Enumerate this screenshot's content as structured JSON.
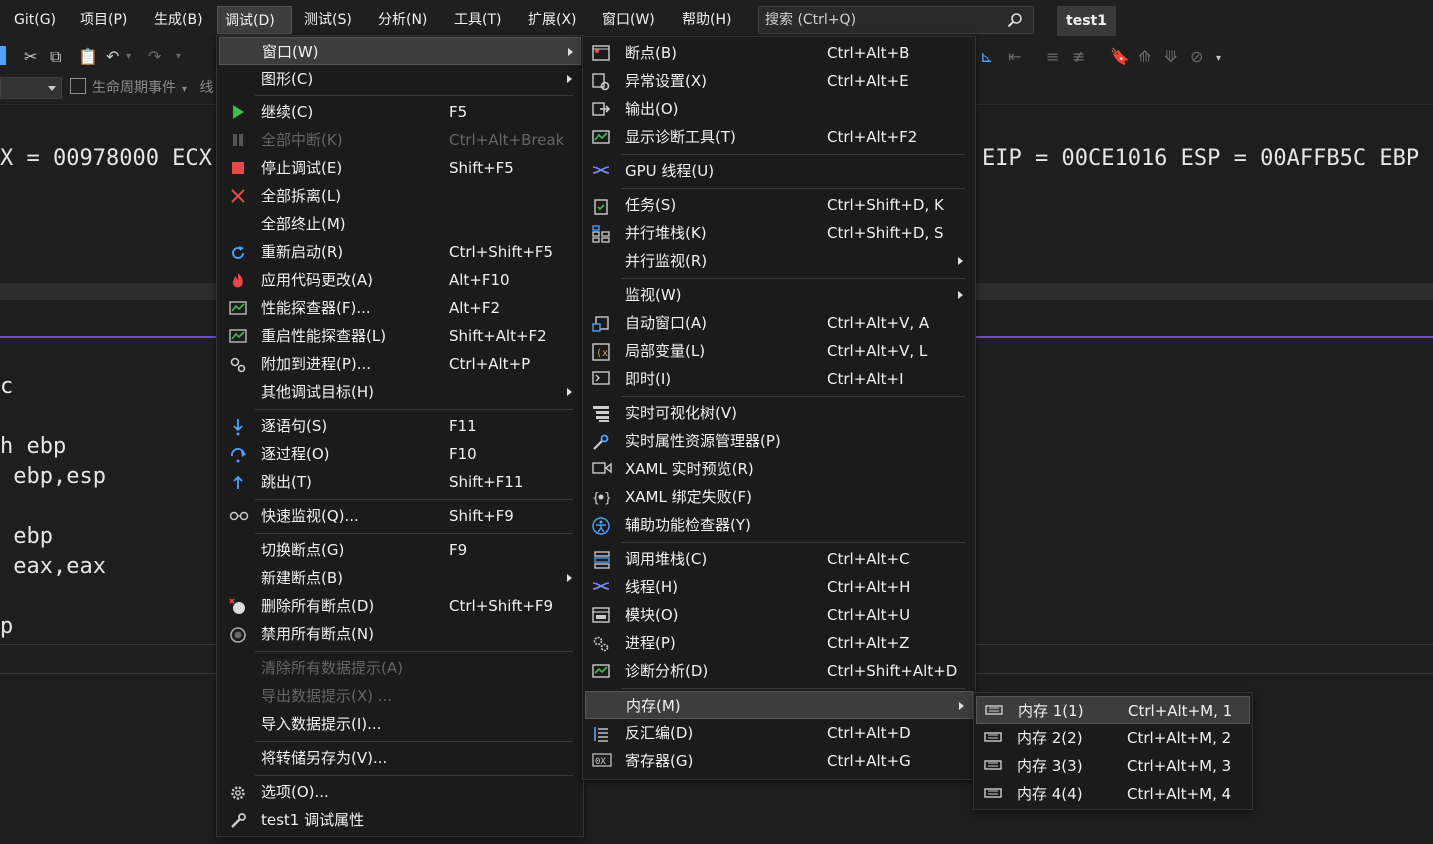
{
  "menubar": {
    "items": [
      {
        "label": "Git(G)"
      },
      {
        "label": "项目(P)"
      },
      {
        "label": "生成(B)"
      },
      {
        "label": "调试(D)"
      },
      {
        "label": "测试(S)"
      },
      {
        "label": "分析(N)"
      },
      {
        "label": "工具(T)"
      },
      {
        "label": "扩展(X)"
      },
      {
        "label": "窗口(W)"
      },
      {
        "label": "帮助(H)"
      }
    ],
    "search_placeholder": "搜索 (Ctrl+Q)",
    "project_name": "test1"
  },
  "toolbar2": {
    "lifecycle_label": "生命周期事件",
    "truncated_text": "线"
  },
  "registers": {
    "left": "X = 00978000 ECX",
    "right": "EIP = 00CE1016 ESP = 00AFFB5C EBP"
  },
  "code": {
    "lines": [
      "c",
      "h ebp",
      " ebp,esp",
      " ebp",
      " eax,eax",
      "p"
    ]
  },
  "debug_menu": {
    "items": [
      {
        "label": "窗口(W)",
        "shortcut": "",
        "icon": "",
        "submenu": true,
        "disabled": false,
        "highlighted": true
      },
      {
        "label": "图形(C)",
        "shortcut": "",
        "icon": "",
        "submenu": true,
        "disabled": false
      },
      {
        "label": "继续(C)",
        "shortcut": "F5",
        "icon": "play-icon",
        "submenu": false,
        "disabled": false
      },
      {
        "label": "全部中断(K)",
        "shortcut": "Ctrl+Alt+Break",
        "icon": "pause-icon",
        "submenu": false,
        "disabled": true
      },
      {
        "label": "停止调试(E)",
        "shortcut": "Shift+F5",
        "icon": "stop-icon",
        "submenu": false,
        "disabled": false
      },
      {
        "label": "全部拆离(L)",
        "shortcut": "",
        "icon": "detach-icon",
        "submenu": false,
        "disabled": false
      },
      {
        "label": "全部终止(M)",
        "shortcut": "",
        "icon": "",
        "submenu": false,
        "disabled": false
      },
      {
        "label": "重新启动(R)",
        "shortcut": "Ctrl+Shift+F5",
        "icon": "restart-icon",
        "submenu": false,
        "disabled": false
      },
      {
        "label": "应用代码更改(A)",
        "shortcut": "Alt+F10",
        "icon": "hot-reload-icon",
        "submenu": false,
        "disabled": false
      },
      {
        "label": "性能探查器(F)...",
        "shortcut": "Alt+F2",
        "icon": "profiler-icon",
        "submenu": false,
        "disabled": false
      },
      {
        "label": "重启性能探查器(L)",
        "shortcut": "Shift+Alt+F2",
        "icon": "profiler-icon",
        "submenu": false,
        "disabled": false
      },
      {
        "label": "附加到进程(P)...",
        "shortcut": "Ctrl+Alt+P",
        "icon": "attach-process-icon",
        "submenu": false,
        "disabled": false
      },
      {
        "label": "其他调试目标(H)",
        "shortcut": "",
        "icon": "",
        "submenu": true,
        "disabled": false
      },
      {
        "label": "逐语句(S)",
        "shortcut": "F11",
        "icon": "step-into-icon",
        "submenu": false,
        "disabled": false
      },
      {
        "label": "逐过程(O)",
        "shortcut": "F10",
        "icon": "step-over-icon",
        "submenu": false,
        "disabled": false
      },
      {
        "label": "跳出(T)",
        "shortcut": "Shift+F11",
        "icon": "step-out-icon",
        "submenu": false,
        "disabled": false
      },
      {
        "label": "快速监视(Q)...",
        "shortcut": "Shift+F9",
        "icon": "glasses-icon",
        "submenu": false,
        "disabled": false
      },
      {
        "label": "切换断点(G)",
        "shortcut": "F9",
        "icon": "",
        "submenu": false,
        "disabled": false
      },
      {
        "label": "新建断点(B)",
        "shortcut": "",
        "icon": "",
        "submenu": true,
        "disabled": false
      },
      {
        "label": "删除所有断点(D)",
        "shortcut": "Ctrl+Shift+F9",
        "icon": "delete-breakpoints-icon",
        "submenu": false,
        "disabled": false
      },
      {
        "label": "禁用所有断点(N)",
        "shortcut": "",
        "icon": "disable-breakpoints-icon",
        "submenu": false,
        "disabled": false
      },
      {
        "label": "清除所有数据提示(A)",
        "shortcut": "",
        "icon": "",
        "submenu": false,
        "disabled": true
      },
      {
        "label": "导出数据提示(X) ...",
        "shortcut": "",
        "icon": "",
        "submenu": false,
        "disabled": true
      },
      {
        "label": "导入数据提示(I)...",
        "shortcut": "",
        "icon": "",
        "submenu": false,
        "disabled": false
      },
      {
        "label": "将转储另存为(V)...",
        "shortcut": "",
        "icon": "",
        "submenu": false,
        "disabled": false
      },
      {
        "label": "选项(O)...",
        "shortcut": "",
        "icon": "gear-icon",
        "submenu": false,
        "disabled": false
      },
      {
        "label": "test1 调试属性",
        "shortcut": "",
        "icon": "wrench-icon",
        "submenu": false,
        "disabled": false
      }
    ]
  },
  "window_menu": {
    "items": [
      {
        "label": "断点(B)",
        "shortcut": "Ctrl+Alt+B",
        "icon": "breakpoints-window-icon",
        "submenu": false
      },
      {
        "label": "异常设置(X)",
        "shortcut": "Ctrl+Alt+E",
        "icon": "exception-settings-icon",
        "submenu": false
      },
      {
        "label": "输出(O)",
        "shortcut": "",
        "icon": "output-icon",
        "submenu": false
      },
      {
        "label": "显示诊断工具(T)",
        "shortcut": "Ctrl+Alt+F2",
        "icon": "diagnostic-tools-icon",
        "submenu": false
      },
      {
        "label": "GPU 线程(U)",
        "shortcut": "",
        "icon": "gpu-threads-icon",
        "submenu": false
      },
      {
        "label": "任务(S)",
        "shortcut": "Ctrl+Shift+D, K",
        "icon": "tasks-icon",
        "submenu": false
      },
      {
        "label": "并行堆栈(K)",
        "shortcut": "Ctrl+Shift+D, S",
        "icon": "parallel-stacks-icon",
        "submenu": false
      },
      {
        "label": "并行监视(R)",
        "shortcut": "",
        "icon": "",
        "submenu": true
      },
      {
        "label": "监视(W)",
        "shortcut": "",
        "icon": "",
        "submenu": true
      },
      {
        "label": "自动窗口(A)",
        "shortcut": "Ctrl+Alt+V, A",
        "icon": "autos-icon",
        "submenu": false
      },
      {
        "label": "局部变量(L)",
        "shortcut": "Ctrl+Alt+V, L",
        "icon": "locals-icon",
        "submenu": false
      },
      {
        "label": "即时(I)",
        "shortcut": "Ctrl+Alt+I",
        "icon": "immediate-icon",
        "submenu": false
      },
      {
        "label": "实时可视化树(V)",
        "shortcut": "",
        "icon": "visual-tree-icon",
        "submenu": false
      },
      {
        "label": "实时属性资源管理器(P)",
        "shortcut": "",
        "icon": "property-explorer-icon",
        "submenu": false
      },
      {
        "label": "XAML 实时预览(R)",
        "shortcut": "",
        "icon": "xaml-preview-icon",
        "submenu": false
      },
      {
        "label": "XAML 绑定失败(F)",
        "shortcut": "",
        "icon": "xaml-binding-icon",
        "submenu": false
      },
      {
        "label": "辅助功能检查器(Y)",
        "shortcut": "",
        "icon": "accessibility-icon",
        "submenu": false
      },
      {
        "label": "调用堆栈(C)",
        "shortcut": "Ctrl+Alt+C",
        "icon": "call-stack-icon",
        "submenu": false
      },
      {
        "label": "线程(H)",
        "shortcut": "Ctrl+Alt+H",
        "icon": "threads-icon",
        "submenu": false
      },
      {
        "label": "模块(O)",
        "shortcut": "Ctrl+Alt+U",
        "icon": "modules-icon",
        "submenu": false
      },
      {
        "label": "进程(P)",
        "shortcut": "Ctrl+Alt+Z",
        "icon": "processes-icon",
        "submenu": false
      },
      {
        "label": "诊断分析(D)",
        "shortcut": "Ctrl+Shift+Alt+D",
        "icon": "diagnostic-analysis-icon",
        "submenu": false
      },
      {
        "label": "内存(M)",
        "shortcut": "",
        "icon": "",
        "submenu": true,
        "highlighted": true
      },
      {
        "label": "反汇编(D)",
        "shortcut": "Ctrl+Alt+D",
        "icon": "disassembly-icon",
        "submenu": false
      },
      {
        "label": "寄存器(G)",
        "shortcut": "Ctrl+Alt+G",
        "icon": "registers-icon",
        "submenu": false
      }
    ]
  },
  "memory_menu": {
    "items": [
      {
        "label": "内存 1(1)",
        "shortcut": "Ctrl+Alt+M, 1",
        "icon": "memory-icon",
        "highlighted": true
      },
      {
        "label": "内存 2(2)",
        "shortcut": "Ctrl+Alt+M, 2",
        "icon": "memory-icon"
      },
      {
        "label": "内存 3(3)",
        "shortcut": "Ctrl+Alt+M, 3",
        "icon": "memory-icon"
      },
      {
        "label": "内存 4(4)",
        "shortcut": "Ctrl+Alt+M, 4",
        "icon": "memory-icon"
      }
    ]
  },
  "colors": {
    "accent_purple": "#6d4fc7",
    "play_green": "#3fb950",
    "stop_red": "#e5484d",
    "icon_blue": "#4da3ff"
  }
}
